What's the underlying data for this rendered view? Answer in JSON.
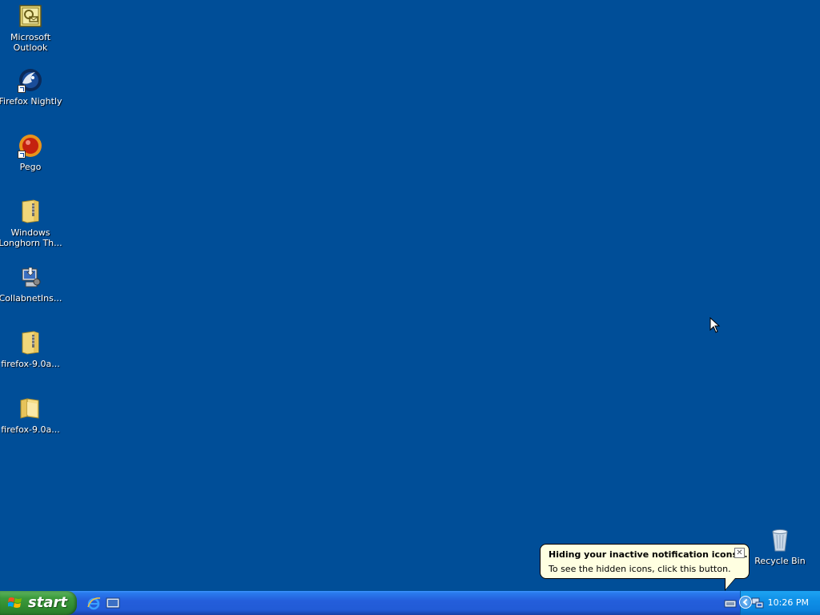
{
  "desktop": {
    "icons": [
      {
        "label": "Microsoft\nOutlook",
        "icon": "outlook-icon"
      },
      {
        "label": "Firefox Nightly",
        "icon": "firefox-nightly-icon"
      },
      {
        "label": "Pego",
        "icon": "pego-icon"
      },
      {
        "label": "Windows\nLonghorn Th...",
        "icon": "zip-folder-icon"
      },
      {
        "label": "CollabnetIns...",
        "icon": "installer-icon"
      },
      {
        "label": "firefox-9.0a...",
        "icon": "zip-folder-icon"
      },
      {
        "label": "firefox-9.0a...",
        "icon": "folder-icon"
      }
    ],
    "recycle_bin": {
      "label": "Recycle Bin",
      "icon": "recycle-bin-icon"
    },
    "background_color": "#004e98"
  },
  "balloon": {
    "title": "Hiding your inactive notification icons...",
    "text": "To see the hidden icons, click this button.",
    "close_symbol": "✕",
    "background_color": "#ffffe1"
  },
  "taskbar": {
    "start_label": "start",
    "quick_launch": [
      {
        "icon": "internet-explorer-icon"
      },
      {
        "icon": "show-desktop-icon"
      }
    ],
    "tray": {
      "clock": "10:26 PM",
      "icons": [
        "keyboard-icon",
        "network-icon"
      ]
    },
    "start_color": "#3c9a3c",
    "bar_color": "#245edb",
    "tray_color": "#0f8fe6"
  }
}
